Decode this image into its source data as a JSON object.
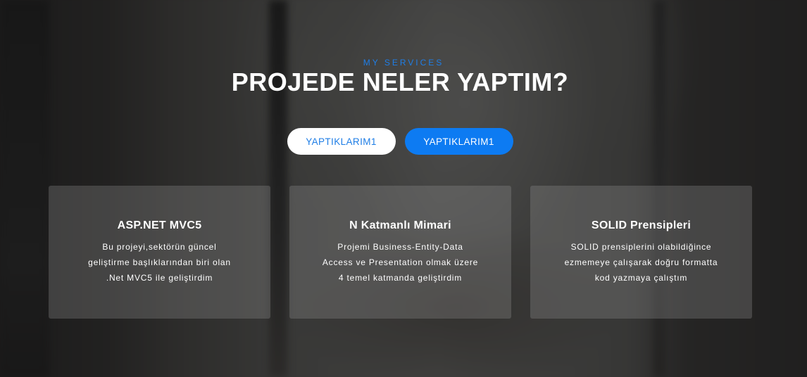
{
  "section": {
    "eyebrow": "MY SERVICES",
    "title": "PROJEDE NELER YAPTIM?"
  },
  "filters": [
    {
      "label": "YAPTIKLARIM1",
      "active": false
    },
    {
      "label": "YAPTIKLARIM1",
      "active": true
    }
  ],
  "cards": [
    {
      "title": "ASP.NET MVC5",
      "lines": [
        "Bu projeyi,sektörün güncel",
        "geliştirme başlıklarından biri olan",
        ".Net MVC5 ile geliştirdim"
      ]
    },
    {
      "title": "N Katmanlı Mimari",
      "lines": [
        "Projemi Business-Entity-Data",
        "Access ve Presentation olmak üzere",
        "4 temel katmanda geliştirdim"
      ]
    },
    {
      "title": "SOLID Prensipleri",
      "lines": [
        "SOLID prensiplerini olabildiğince",
        "ezmemeye çalışarak doğru formatta",
        "kod yazmaya çalıştım"
      ]
    }
  ],
  "colors": {
    "accent": "#0d7bf2",
    "eyebrow": "#1f7ee6",
    "text": "#ffffff"
  }
}
